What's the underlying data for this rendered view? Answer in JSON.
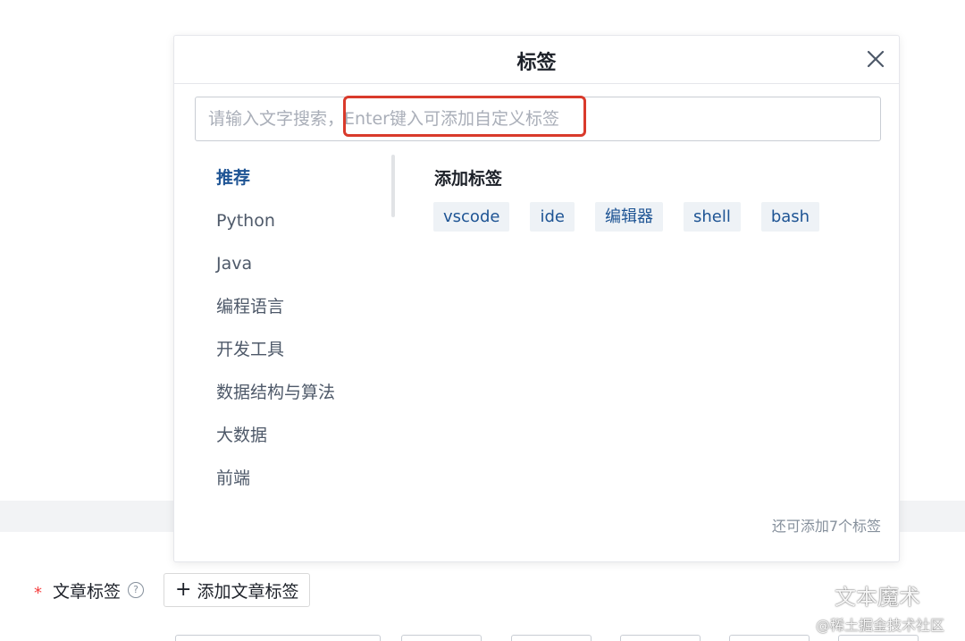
{
  "modal": {
    "title": "标签",
    "search_placeholder": "请输入文字搜索，Enter键入可添加自定义标签",
    "categories": [
      "推荐",
      "Python",
      "Java",
      "编程语言",
      "开发工具",
      "数据结构与算法",
      "大数据",
      "前端"
    ],
    "section_title": "添加标签",
    "tags": [
      "vscode",
      "ide",
      "编辑器",
      "shell",
      "bash"
    ],
    "remaining_hint": "还可添加7个标签"
  },
  "form": {
    "required_mark": "*",
    "label": "文章标签",
    "help_symbol": "?",
    "add_button_label": "添加文章标签"
  },
  "watermark": {
    "brand": "文本魔术",
    "credit": "@稀土掘金技术社区"
  },
  "colors": {
    "accent": "#1e5494",
    "chip_bg": "#eef2f6",
    "highlight": "#d93a2b",
    "required": "#f53f3f"
  }
}
